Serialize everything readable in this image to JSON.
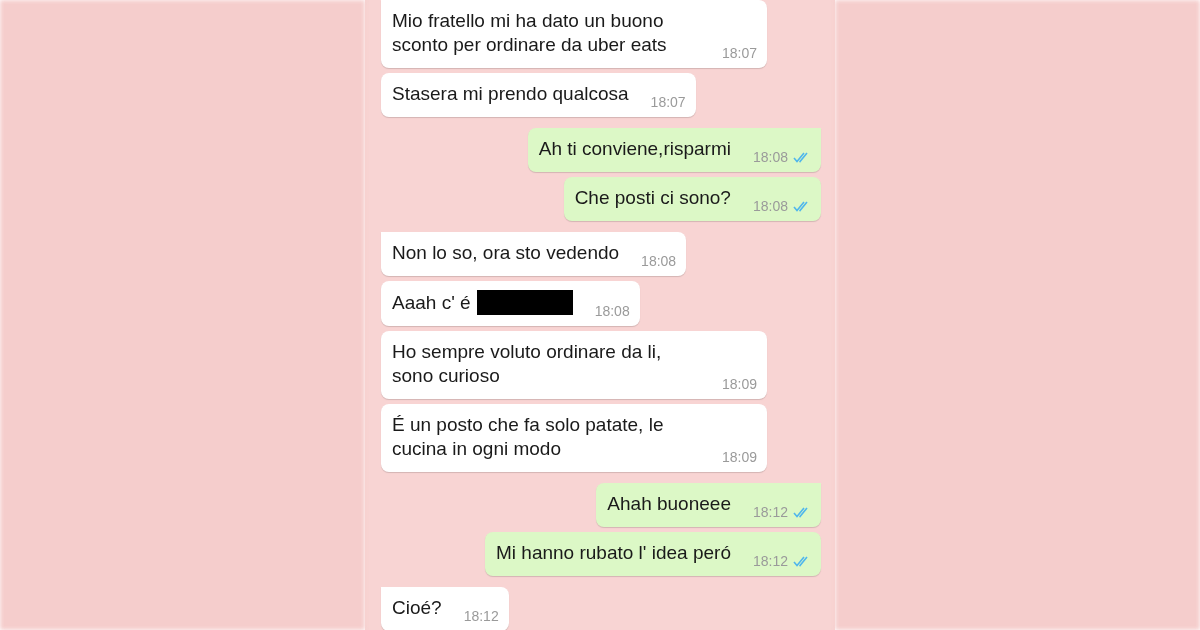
{
  "messages": [
    {
      "kind": "received",
      "text": "Mio fratello mi ha dato un buono sconto per ordinare da uber eats",
      "time": "18:07",
      "tail": true
    },
    {
      "kind": "received",
      "text": "Stasera mi prendo qualcosa",
      "time": "18:07",
      "tail": false
    },
    {
      "kind": "sent",
      "text": "Ah ti conviene,risparmi",
      "time": "18:08",
      "tail": true,
      "read": true
    },
    {
      "kind": "sent",
      "text": "Che posti ci sono?",
      "time": "18:08",
      "tail": false,
      "read": true
    },
    {
      "kind": "received",
      "text": "Non lo so, ora sto vedendo",
      "time": "18:08",
      "tail": true
    },
    {
      "kind": "received",
      "text": "Aaah c' é",
      "time": "18:08",
      "tail": false,
      "redacted": true
    },
    {
      "kind": "received",
      "text": "Ho sempre voluto ordinare da li, sono curioso",
      "time": "18:09",
      "tail": false
    },
    {
      "kind": "received",
      "text": "É un posto che fa solo patate, le cucina in ogni modo",
      "time": "18:09",
      "tail": false
    },
    {
      "kind": "sent",
      "text": "Ahah buoneee",
      "time": "18:12",
      "tail": true,
      "read": true
    },
    {
      "kind": "sent",
      "text": "Mi hanno rubato l' idea peró",
      "time": "18:12",
      "tail": false,
      "read": true
    },
    {
      "kind": "received",
      "text": "Cioé?",
      "time": "18:12",
      "tail": true
    }
  ]
}
